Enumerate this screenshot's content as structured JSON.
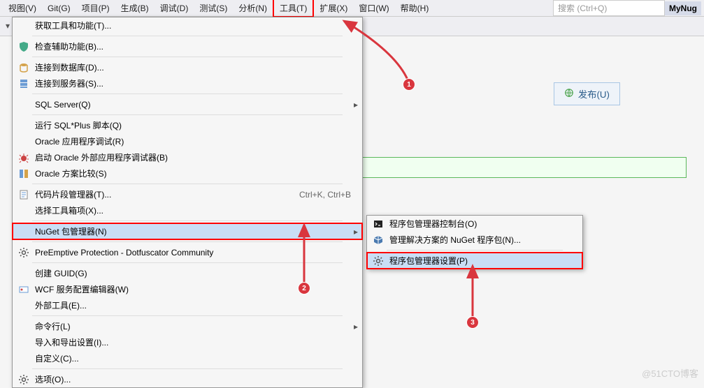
{
  "menubar": {
    "items": [
      "视图(V)",
      "Git(G)",
      "项目(P)",
      "生成(B)",
      "调试(D)",
      "测试(S)",
      "分析(N)",
      "工具(T)",
      "扩展(X)",
      "窗口(W)",
      "帮助(H)"
    ],
    "tools_index": 7,
    "search_placeholder": "搜索 (Ctrl+Q)",
    "project_label": "MyNug"
  },
  "dropdown": [
    {
      "label": "获取工具和功能(T)...",
      "sep_after": true
    },
    {
      "icon": "shield",
      "label": "检查辅助功能(B)...",
      "sep_after": true
    },
    {
      "icon": "db",
      "label": "连接到数据库(D)..."
    },
    {
      "icon": "server",
      "label": "连接到服务器(S)...",
      "sep_after": true
    },
    {
      "label": "SQL Server(Q)",
      "chev": true,
      "sep_after": true
    },
    {
      "label": "运行 SQL*Plus 脚本(Q)"
    },
    {
      "label": "Oracle 应用程序调试(R)"
    },
    {
      "icon": "bug",
      "label": "启动 Oracle 外部应用程序调试器(B)"
    },
    {
      "icon": "compare",
      "label": "Oracle 方案比较(S)",
      "sep_after": true
    },
    {
      "icon": "snippet",
      "label": "代码片段管理器(T)...",
      "shortcut": "Ctrl+K, Ctrl+B"
    },
    {
      "label": "选择工具箱项(X)...",
      "sep_after": true
    },
    {
      "label": "NuGet 包管理器(N)",
      "chev": true,
      "highlight": true,
      "redbox": true,
      "sep_after": true
    },
    {
      "icon": "gear",
      "label": "PreEmptive Protection - Dotfuscator Community",
      "sep_after": true
    },
    {
      "label": "创建 GUID(G)"
    },
    {
      "icon": "wcf",
      "label": "WCF 服务配置编辑器(W)"
    },
    {
      "label": "外部工具(E)...",
      "sep_after": true
    },
    {
      "label": "命令行(L)",
      "chev": true
    },
    {
      "label": "导入和导出设置(I)..."
    },
    {
      "label": "自定义(C)...",
      "sep_after": true
    },
    {
      "icon": "gear",
      "label": "选项(O)..."
    }
  ],
  "submenu": [
    {
      "icon": "console",
      "label": "程序包管理器控制台(O)"
    },
    {
      "icon": "pkg",
      "label": "管理解决方案的 NuGet 程序包(N)...",
      "sep_after": true
    },
    {
      "icon": "gear",
      "label": "程序包管理器设置(P)",
      "highlight": true,
      "redbox": true
    }
  ],
  "publish_label": "发布(U)",
  "badges": [
    "1",
    "2",
    "3"
  ],
  "watermark": "@51CTO博客"
}
